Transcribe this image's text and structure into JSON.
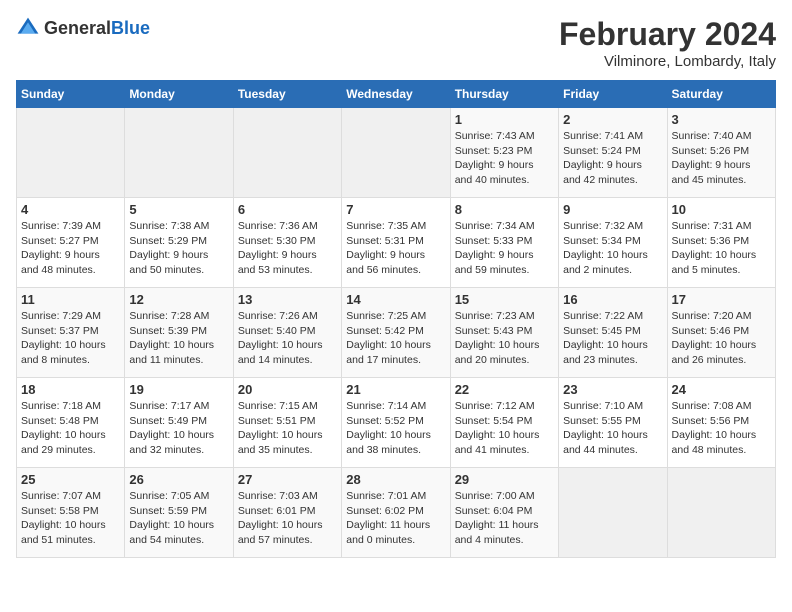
{
  "logo": {
    "general": "General",
    "blue": "Blue"
  },
  "title": "February 2024",
  "subtitle": "Vilminore, Lombardy, Italy",
  "days_header": [
    "Sunday",
    "Monday",
    "Tuesday",
    "Wednesday",
    "Thursday",
    "Friday",
    "Saturday"
  ],
  "weeks": [
    [
      {
        "day": "",
        "detail": ""
      },
      {
        "day": "",
        "detail": ""
      },
      {
        "day": "",
        "detail": ""
      },
      {
        "day": "",
        "detail": ""
      },
      {
        "day": "1",
        "detail": "Sunrise: 7:43 AM\nSunset: 5:23 PM\nDaylight: 9 hours\nand 40 minutes."
      },
      {
        "day": "2",
        "detail": "Sunrise: 7:41 AM\nSunset: 5:24 PM\nDaylight: 9 hours\nand 42 minutes."
      },
      {
        "day": "3",
        "detail": "Sunrise: 7:40 AM\nSunset: 5:26 PM\nDaylight: 9 hours\nand 45 minutes."
      }
    ],
    [
      {
        "day": "4",
        "detail": "Sunrise: 7:39 AM\nSunset: 5:27 PM\nDaylight: 9 hours\nand 48 minutes."
      },
      {
        "day": "5",
        "detail": "Sunrise: 7:38 AM\nSunset: 5:29 PM\nDaylight: 9 hours\nand 50 minutes."
      },
      {
        "day": "6",
        "detail": "Sunrise: 7:36 AM\nSunset: 5:30 PM\nDaylight: 9 hours\nand 53 minutes."
      },
      {
        "day": "7",
        "detail": "Sunrise: 7:35 AM\nSunset: 5:31 PM\nDaylight: 9 hours\nand 56 minutes."
      },
      {
        "day": "8",
        "detail": "Sunrise: 7:34 AM\nSunset: 5:33 PM\nDaylight: 9 hours\nand 59 minutes."
      },
      {
        "day": "9",
        "detail": "Sunrise: 7:32 AM\nSunset: 5:34 PM\nDaylight: 10 hours\nand 2 minutes."
      },
      {
        "day": "10",
        "detail": "Sunrise: 7:31 AM\nSunset: 5:36 PM\nDaylight: 10 hours\nand 5 minutes."
      }
    ],
    [
      {
        "day": "11",
        "detail": "Sunrise: 7:29 AM\nSunset: 5:37 PM\nDaylight: 10 hours\nand 8 minutes."
      },
      {
        "day": "12",
        "detail": "Sunrise: 7:28 AM\nSunset: 5:39 PM\nDaylight: 10 hours\nand 11 minutes."
      },
      {
        "day": "13",
        "detail": "Sunrise: 7:26 AM\nSunset: 5:40 PM\nDaylight: 10 hours\nand 14 minutes."
      },
      {
        "day": "14",
        "detail": "Sunrise: 7:25 AM\nSunset: 5:42 PM\nDaylight: 10 hours\nand 17 minutes."
      },
      {
        "day": "15",
        "detail": "Sunrise: 7:23 AM\nSunset: 5:43 PM\nDaylight: 10 hours\nand 20 minutes."
      },
      {
        "day": "16",
        "detail": "Sunrise: 7:22 AM\nSunset: 5:45 PM\nDaylight: 10 hours\nand 23 minutes."
      },
      {
        "day": "17",
        "detail": "Sunrise: 7:20 AM\nSunset: 5:46 PM\nDaylight: 10 hours\nand 26 minutes."
      }
    ],
    [
      {
        "day": "18",
        "detail": "Sunrise: 7:18 AM\nSunset: 5:48 PM\nDaylight: 10 hours\nand 29 minutes."
      },
      {
        "day": "19",
        "detail": "Sunrise: 7:17 AM\nSunset: 5:49 PM\nDaylight: 10 hours\nand 32 minutes."
      },
      {
        "day": "20",
        "detail": "Sunrise: 7:15 AM\nSunset: 5:51 PM\nDaylight: 10 hours\nand 35 minutes."
      },
      {
        "day": "21",
        "detail": "Sunrise: 7:14 AM\nSunset: 5:52 PM\nDaylight: 10 hours\nand 38 minutes."
      },
      {
        "day": "22",
        "detail": "Sunrise: 7:12 AM\nSunset: 5:54 PM\nDaylight: 10 hours\nand 41 minutes."
      },
      {
        "day": "23",
        "detail": "Sunrise: 7:10 AM\nSunset: 5:55 PM\nDaylight: 10 hours\nand 44 minutes."
      },
      {
        "day": "24",
        "detail": "Sunrise: 7:08 AM\nSunset: 5:56 PM\nDaylight: 10 hours\nand 48 minutes."
      }
    ],
    [
      {
        "day": "25",
        "detail": "Sunrise: 7:07 AM\nSunset: 5:58 PM\nDaylight: 10 hours\nand 51 minutes."
      },
      {
        "day": "26",
        "detail": "Sunrise: 7:05 AM\nSunset: 5:59 PM\nDaylight: 10 hours\nand 54 minutes."
      },
      {
        "day": "27",
        "detail": "Sunrise: 7:03 AM\nSunset: 6:01 PM\nDaylight: 10 hours\nand 57 minutes."
      },
      {
        "day": "28",
        "detail": "Sunrise: 7:01 AM\nSunset: 6:02 PM\nDaylight: 11 hours\nand 0 minutes."
      },
      {
        "day": "29",
        "detail": "Sunrise: 7:00 AM\nSunset: 6:04 PM\nDaylight: 11 hours\nand 4 minutes."
      },
      {
        "day": "",
        "detail": ""
      },
      {
        "day": "",
        "detail": ""
      }
    ]
  ]
}
